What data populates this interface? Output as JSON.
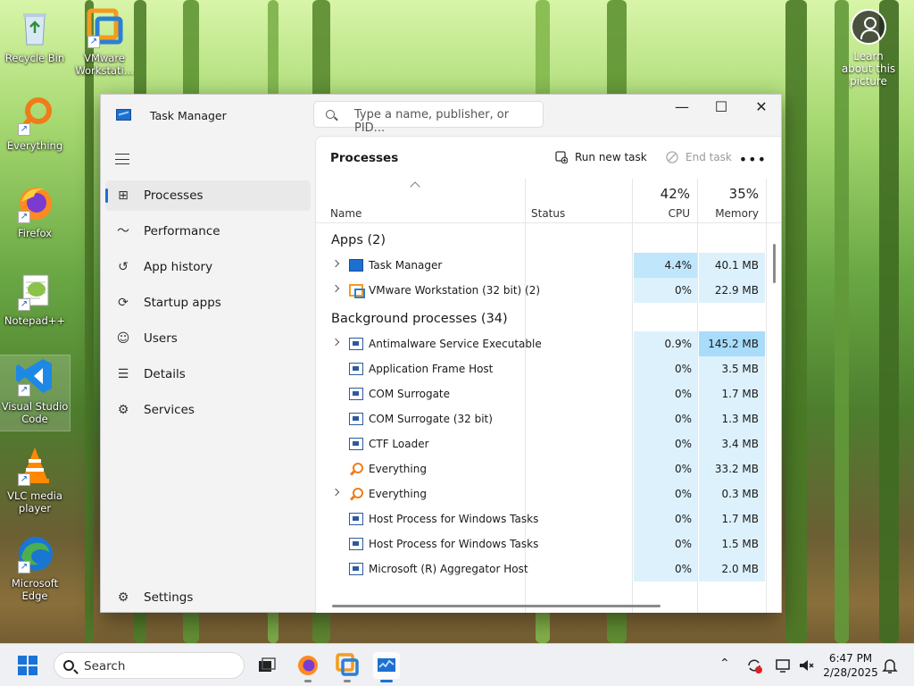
{
  "desktop": {
    "icons": [
      {
        "label": "Recycle Bin"
      },
      {
        "label": "VMware Workstati..."
      },
      {
        "label": "Everything"
      },
      {
        "label": "Firefox"
      },
      {
        "label": "Notepad++"
      },
      {
        "label": "Visual Studio Code"
      },
      {
        "label": "VLC media player"
      },
      {
        "label": "Microsoft Edge"
      }
    ],
    "learn_label": "Learn about this picture"
  },
  "window": {
    "title": "Task Manager",
    "search_placeholder": "Type a name, publisher, or PID...",
    "controls": {
      "minimize": "—",
      "maximize": "☐",
      "close": "✕"
    }
  },
  "nav": {
    "items": [
      {
        "label": "Processes",
        "icon": "processes-icon"
      },
      {
        "label": "Performance",
        "icon": "performance-icon"
      },
      {
        "label": "App history",
        "icon": "app-history-icon"
      },
      {
        "label": "Startup apps",
        "icon": "startup-apps-icon"
      },
      {
        "label": "Users",
        "icon": "users-icon"
      },
      {
        "label": "Details",
        "icon": "details-icon"
      },
      {
        "label": "Services",
        "icon": "services-icon"
      }
    ],
    "settings_label": "Settings",
    "active": "Processes"
  },
  "main": {
    "title": "Processes",
    "run_new_task": "Run new task",
    "end_task": "End task",
    "more": "•••",
    "columns": {
      "name": "Name",
      "status": "Status",
      "cpu_pct": "42%",
      "cpu": "CPU",
      "mem_pct": "35%",
      "memory": "Memory"
    },
    "groups": [
      {
        "label": "Apps (2)",
        "rows": [
          {
            "name": "Task Manager",
            "icon": "task-manager-icon",
            "expandable": true,
            "cpu": "4.4%",
            "mem": "40.1 MB",
            "hot_cpu": true,
            "hot_mem": false
          },
          {
            "name": "VMware Workstation (32 bit) (2)",
            "icon": "vmware-icon",
            "expandable": true,
            "cpu": "0%",
            "mem": "22.9 MB",
            "hot_cpu": false,
            "hot_mem": false
          }
        ]
      },
      {
        "label": "Background processes (34)",
        "rows": [
          {
            "name": "Antimalware Service Executable",
            "icon": "process-icon",
            "expandable": true,
            "cpu": "0.9%",
            "mem": "145.2 MB",
            "hot_cpu": false,
            "hot_mem": true
          },
          {
            "name": "Application Frame Host",
            "icon": "process-icon",
            "expandable": false,
            "cpu": "0%",
            "mem": "3.5 MB",
            "hot_cpu": false,
            "hot_mem": false
          },
          {
            "name": "COM Surrogate",
            "icon": "process-icon",
            "expandable": false,
            "cpu": "0%",
            "mem": "1.7 MB",
            "hot_cpu": false,
            "hot_mem": false
          },
          {
            "name": "COM Surrogate (32 bit)",
            "icon": "process-icon",
            "expandable": false,
            "cpu": "0%",
            "mem": "1.3 MB",
            "hot_cpu": false,
            "hot_mem": false
          },
          {
            "name": "CTF Loader",
            "icon": "process-icon",
            "expandable": false,
            "cpu": "0%",
            "mem": "3.4 MB",
            "hot_cpu": false,
            "hot_mem": false
          },
          {
            "name": "Everything",
            "icon": "everything-icon",
            "expandable": false,
            "cpu": "0%",
            "mem": "33.2 MB",
            "hot_cpu": false,
            "hot_mem": false
          },
          {
            "name": "Everything",
            "icon": "everything-icon",
            "expandable": true,
            "cpu": "0%",
            "mem": "0.3 MB",
            "hot_cpu": false,
            "hot_mem": false
          },
          {
            "name": "Host Process for Windows Tasks",
            "icon": "process-icon",
            "expandable": false,
            "cpu": "0%",
            "mem": "1.7 MB",
            "hot_cpu": false,
            "hot_mem": false
          },
          {
            "name": "Host Process for Windows Tasks",
            "icon": "process-icon",
            "expandable": false,
            "cpu": "0%",
            "mem": "1.5 MB",
            "hot_cpu": false,
            "hot_mem": false
          },
          {
            "name": "Microsoft (R) Aggregator Host",
            "icon": "process-icon",
            "expandable": false,
            "cpu": "0%",
            "mem": "2.0 MB",
            "hot_cpu": false,
            "hot_mem": false
          }
        ]
      }
    ]
  },
  "taskbar": {
    "search_label": "Search",
    "time": "6:47 PM",
    "date": "2/28/2025",
    "accent": "#1f6fd1"
  }
}
